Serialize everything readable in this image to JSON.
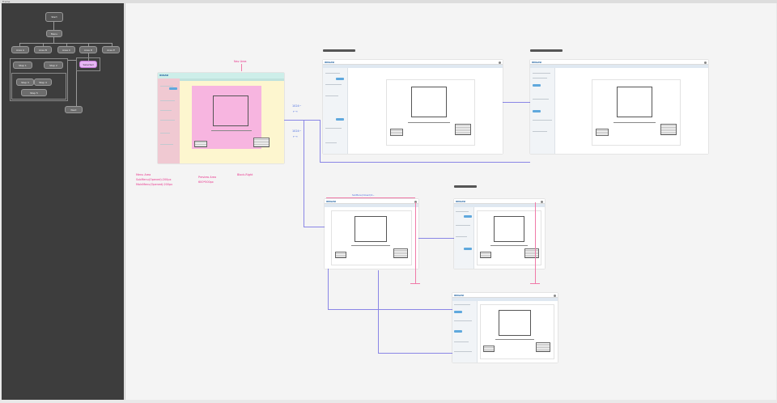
{
  "page": {
    "top_label": "Frame"
  },
  "flow": {
    "nodes": [
      {
        "id": "n1",
        "label": "Start"
      },
      {
        "id": "n2",
        "label": "Menu"
      },
      {
        "id": "n3",
        "label": "Area A"
      },
      {
        "id": "n4",
        "label": "Area B"
      },
      {
        "id": "n5",
        "label": "Area C"
      },
      {
        "id": "n6",
        "label": "Area D"
      },
      {
        "id": "n7",
        "label": "Area E"
      },
      {
        "id": "n8",
        "label": "Step 1"
      },
      {
        "id": "n9",
        "label": "Step 2"
      },
      {
        "id": "n10",
        "label": "Step 3"
      },
      {
        "id": "n11",
        "label": "Step 4"
      },
      {
        "id": "n12",
        "label": "Step 5"
      },
      {
        "id": "n13",
        "label": "Selected"
      },
      {
        "id": "n14",
        "label": "Next"
      }
    ]
  },
  "annotations": {
    "nav_area": "Nav Area",
    "menu_area": "Menu Area",
    "submenu": "SubMenu(Opened):200px",
    "mainmenu": "MainMenu(Opened):200px",
    "preview_area": "Preview Area",
    "preview_size": "600*500px",
    "block_right": "Block-Right",
    "w1024": "1024~",
    "w1024_b": "1024~",
    "arrow": "←→",
    "arrow_b": "←→",
    "mid_note": "SubMenu(Closed):0~"
  },
  "frames": {
    "logo": "IRUGASI",
    "logo_label": "IRUGASI"
  },
  "colors": {
    "nav_highlight": "#cdeee9",
    "menu_highlight": "#f0c9d2",
    "preview_highlight": "#f7b5e0",
    "block_right_highlight": "#fdf6cf",
    "accent": "#5fa8dd",
    "annotation_pink": "#e8318a",
    "annotation_blue": "#4b6de0"
  }
}
